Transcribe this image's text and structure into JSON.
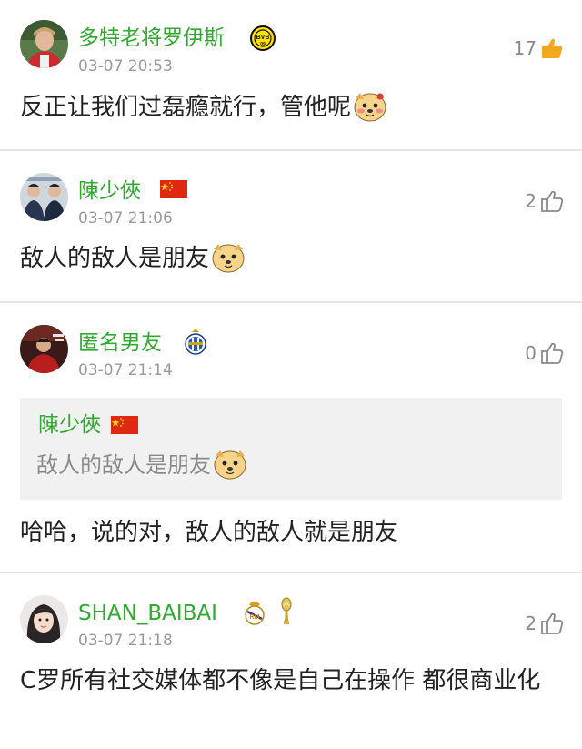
{
  "comments": [
    {
      "username": "多特老将罗伊斯",
      "timestamp": "03-07 20:53",
      "likes": "17",
      "liked": true,
      "text": "反正让我们过磊瘾就行，管他呢",
      "badge_icon": "bvb-badge-icon",
      "emoji_icon": "dog-emoji-icon"
    },
    {
      "username": "陳少俠",
      "timestamp": "03-07 21:06",
      "likes": "2",
      "liked": false,
      "text": "敌人的敌人是朋友",
      "badge_icon": "china-flag-icon",
      "emoji_icon": "dog-emoji-icon"
    },
    {
      "username": "匿名男友",
      "timestamp": "03-07 21:14",
      "likes": "0",
      "liked": false,
      "text": "哈哈，说的对，敌人的敌人就是朋友",
      "badge_icon": "espanyol-badge-icon",
      "quote": {
        "username": "陳少俠",
        "text": "敌人的敌人是朋友"
      }
    },
    {
      "username": "SHAN_BAIBAI",
      "timestamp": "03-07 21:18",
      "likes": "2",
      "liked": false,
      "text": "C罗所有社交媒体都不像是自己在操作 都很商业化",
      "badge_icon": "real-madrid-badge-icon",
      "trophy_icon": "trophy-icon"
    }
  ],
  "colors": {
    "username": "#2faa2f",
    "timestamp": "#9a9a9a",
    "liked_thumb": "#f4a820",
    "unliked_thumb": "#8a8a8a",
    "divider": "#e6e6e6",
    "quote_bg": "#f1f1f1"
  }
}
